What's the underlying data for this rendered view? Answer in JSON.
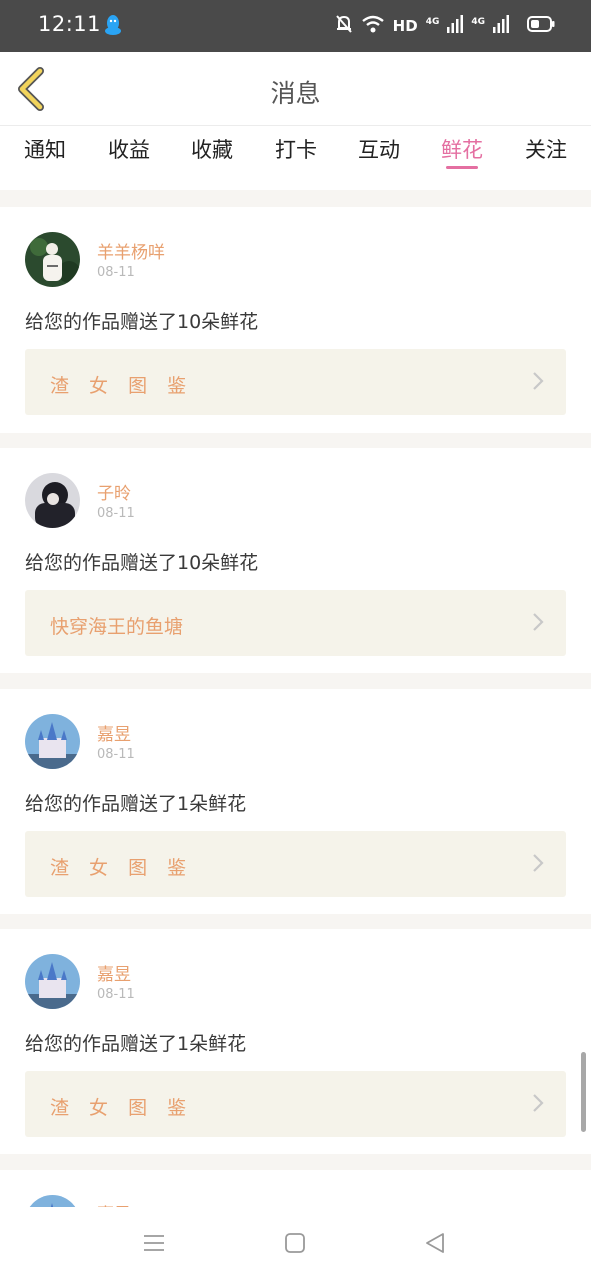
{
  "status_bar": {
    "time": "12:11",
    "hd": "HD",
    "net1": "4G",
    "net2": "4G",
    "icons": [
      "qq-icon",
      "mute-bell-icon",
      "wifi-icon",
      "signal-icon",
      "battery-icon"
    ]
  },
  "header": {
    "title": "消息"
  },
  "tabs": [
    {
      "label": "通知"
    },
    {
      "label": "收益"
    },
    {
      "label": "收藏"
    },
    {
      "label": "打卡"
    },
    {
      "label": "互动"
    },
    {
      "label": "鲜花",
      "active": true
    },
    {
      "label": "关注"
    }
  ],
  "messages": [
    {
      "user": "羊羊杨咩",
      "date": "08-11",
      "text": "给您的作品赠送了10朵鲜花",
      "work": "渣 女 图 鉴"
    },
    {
      "user": "子昤",
      "date": "08-11",
      "text": "给您的作品赠送了10朵鲜花",
      "work": "快穿海王的鱼塘"
    },
    {
      "user": "嘉昱",
      "date": "08-11",
      "text": "给您的作品赠送了1朵鲜花",
      "work": "渣 女 图 鉴"
    },
    {
      "user": "嘉昱",
      "date": "08-11",
      "text": "给您的作品赠送了1朵鲜花",
      "work": "渣 女 图 鉴"
    },
    {
      "user": "嘉昱"
    }
  ],
  "colors": {
    "accent_pink": "#e46fa1",
    "name_orange": "#e8a06f",
    "link_bg": "#f5f3ea",
    "status_bar": "#4a4a4a"
  },
  "bottom_nav": {
    "icons": [
      "menu-icon",
      "home-square-icon",
      "back-triangle-icon"
    ]
  }
}
